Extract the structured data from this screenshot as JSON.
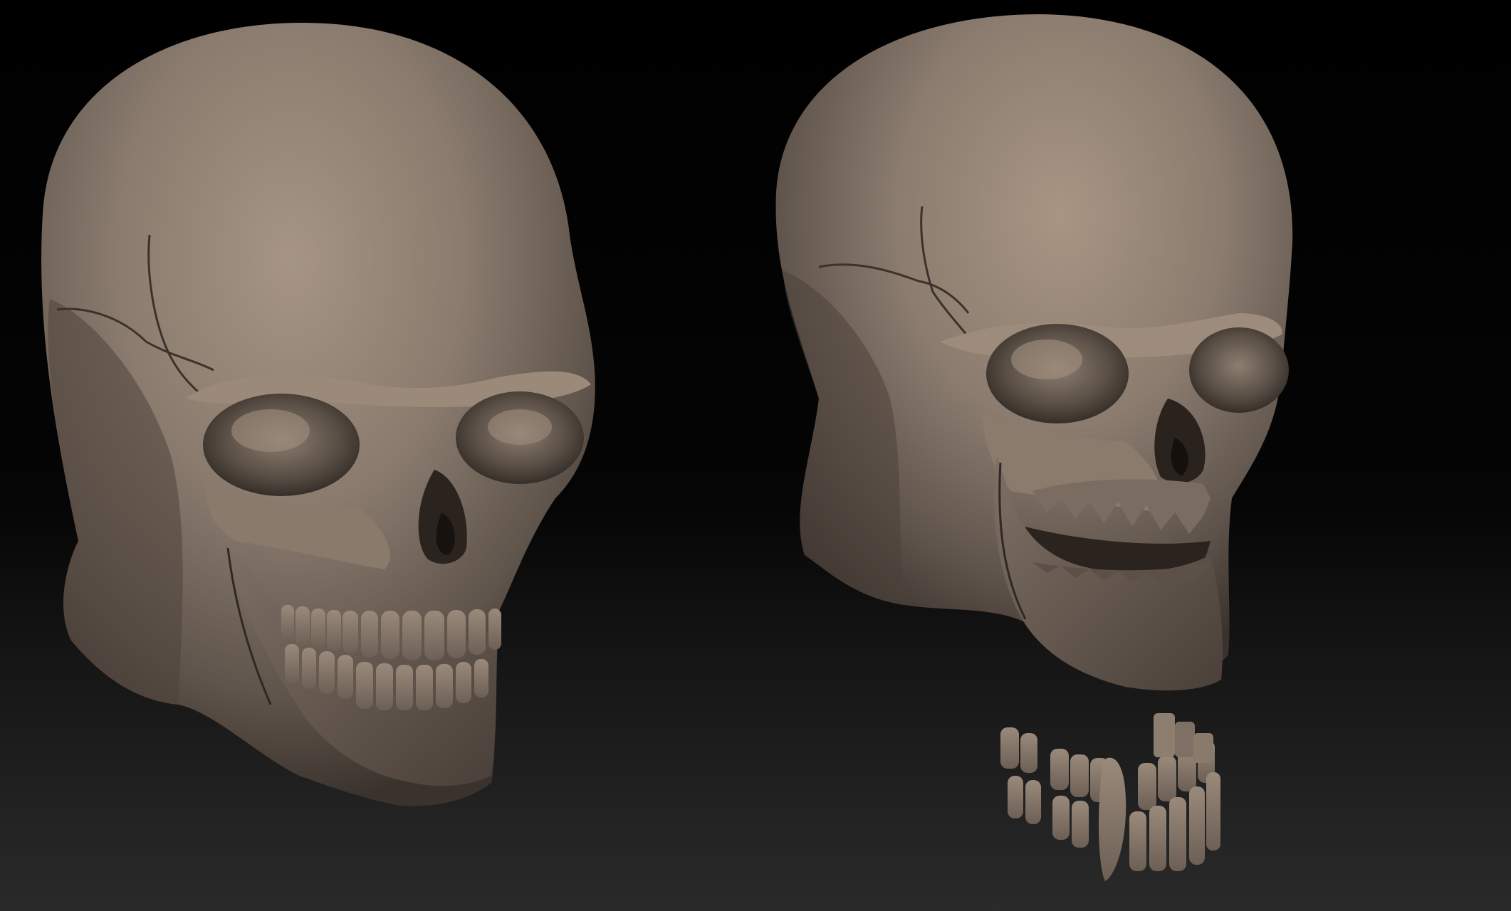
{
  "scene": {
    "description_free": true,
    "background": {
      "top": "#000000",
      "bottom": "#2a2a2a"
    },
    "material_color": "#7f7166",
    "material_light": "#a49383",
    "material_dark": "#3b332d",
    "objects": [
      {
        "name": "skull-closed-jaw",
        "icon": "skull-icon"
      },
      {
        "name": "skull-open-jaw",
        "icon": "skull-icon"
      },
      {
        "name": "loose-teeth-set",
        "icon": "teeth-icon"
      }
    ]
  }
}
